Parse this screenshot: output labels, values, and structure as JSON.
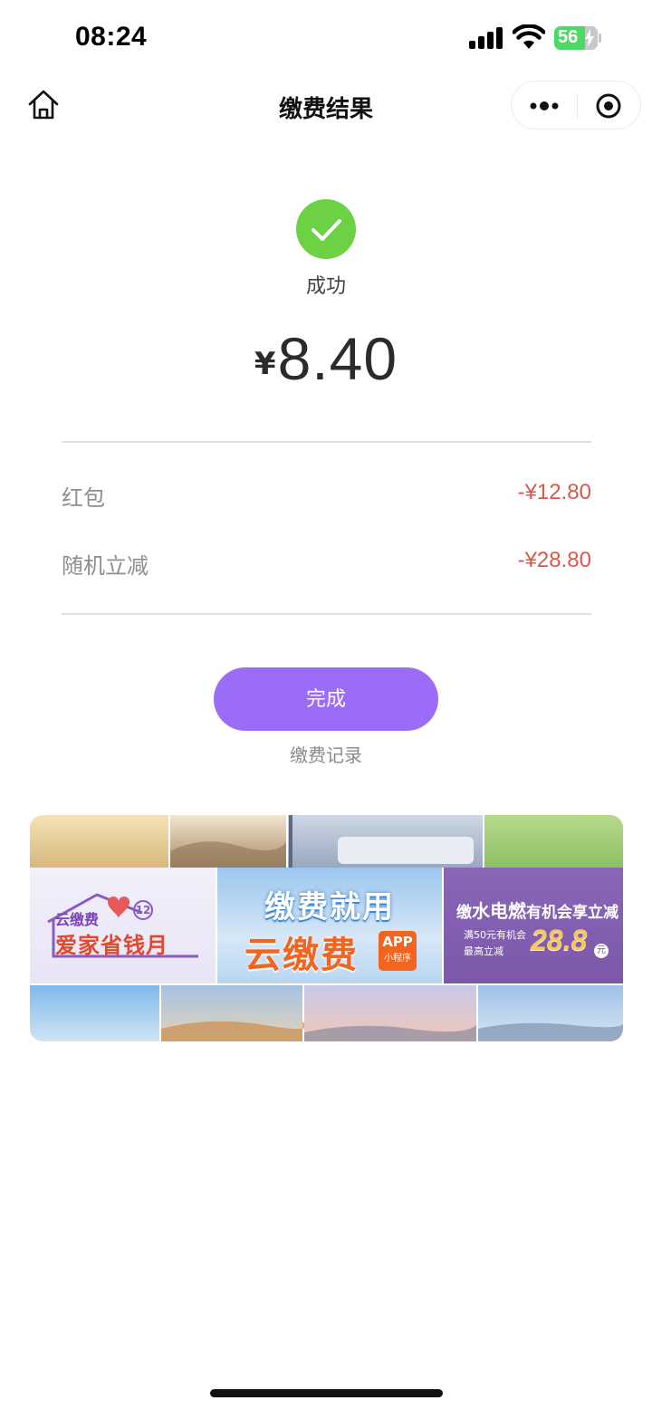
{
  "status_bar": {
    "time": "08:24",
    "battery": "56"
  },
  "nav": {
    "title": "缴费结果",
    "icons": [
      "home-icon",
      "more-icon",
      "close-miniprogram-icon"
    ]
  },
  "result": {
    "icon": "check-icon",
    "status": "成功",
    "currency": "¥",
    "amount": "8.40"
  },
  "discounts": [
    {
      "label": "红包",
      "value": "-¥12.80"
    },
    {
      "label": "随机立减",
      "value": "-¥28.80"
    }
  ],
  "actions": {
    "done_label": "完成",
    "record_link": "缴费记录"
  },
  "banner": {
    "promo1": {
      "brand": "云缴费",
      "badge": "12",
      "title": "爱家省钱月"
    },
    "promo2": {
      "line1": "缴费就用",
      "line2": "云缴费",
      "app": "APP",
      "app_sub": "小程序"
    },
    "promo3": {
      "line1_a": "缴",
      "line1_b": "水电燃",
      "line1_c": "有机会享立减",
      "line2": "满50元有机会",
      "line3": "最高立减",
      "amount": "28.8",
      "unit": "元"
    }
  },
  "colors": {
    "accent": "#9b6cf7",
    "success": "#6dd144",
    "discount": "#d9584a"
  }
}
